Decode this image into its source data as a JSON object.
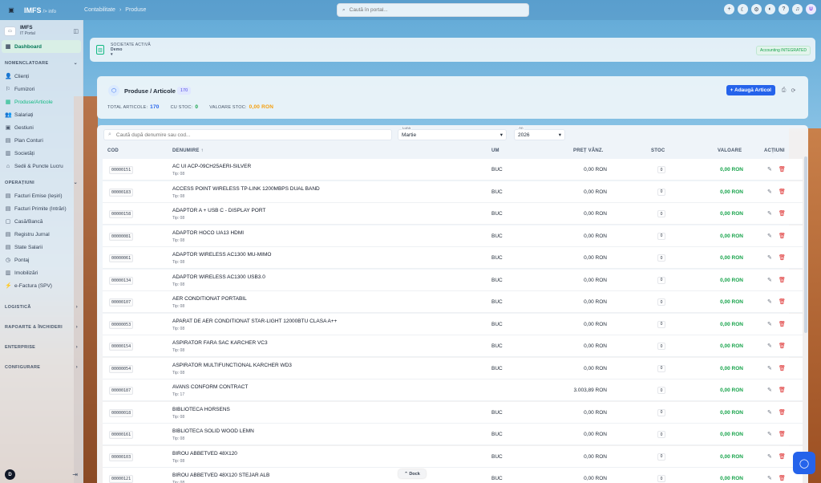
{
  "topbar": {
    "brand": "IMFS",
    "brand_sub": "/> info",
    "crumb1": "Contabilitate",
    "crumb2": "Produse",
    "search_placeholder": "Caută în portal...",
    "avatar": "U"
  },
  "sidebar": {
    "title": "IMFS",
    "subtitle": "IT Portal",
    "dashboard": "Dashboard",
    "sec1": "NOMENCLATOARE",
    "items1": [
      "Clienți",
      "Furnizori",
      "Produse/Articole",
      "Salariați",
      "Gestiuni",
      "Plan Conturi",
      "Societăți",
      "Sedii & Puncte Lucru"
    ],
    "sec2": "OPERAȚIUNI",
    "items2": [
      "Facturi Emise (Ieșiri)",
      "Facturi Primite (Intrări)",
      "Casă/Bancă",
      "Registru Jurnal",
      "State Salarii",
      "Pontaj",
      "Imobilizări",
      "e-Factura (SPV)"
    ],
    "sec3": "LOGISTICĂ",
    "sec4": "RAPOARTE & ÎNCHIDERI",
    "sec5": "ENTERPRISE",
    "sec6": "CONFIGURARE",
    "foot_avatar": "D"
  },
  "company": {
    "label": "SOCIETATE ACTIVĂ",
    "name": "Demo",
    "badge": "Accounting INTEGRATED"
  },
  "products": {
    "title": "Produse / Articole",
    "count": "170",
    "total_label": "TOTAL ARTICOLE:",
    "total": "170",
    "stoc_label": "CU STOC:",
    "stoc": "0",
    "val_label": "VALOARE STOC:",
    "val": "0,00 RON",
    "add": "+ Adaugă Articol"
  },
  "filters": {
    "search_placeholder": "Caută după denumire sau cod...",
    "luna_label": "Luna",
    "luna": "Martie",
    "an_label": "An",
    "an": "2026"
  },
  "cols": {
    "cod": "COD",
    "den": "DENUMIRE ↑",
    "um": "UM",
    "pret": "PREȚ VÂNZ.",
    "stoc": "STOC",
    "val": "VALOARE",
    "act": "ACȚIUNI"
  },
  "rows": [
    {
      "code": "00000151",
      "name": "AC UI ACP-09CH25AERI-SILVER",
      "tip": "Tip: 08",
      "um": "BUC",
      "pret": "0,00 RON",
      "stoc": "0",
      "val": "0,00 RON"
    },
    {
      "code": "00000183",
      "name": "ACCESS POINT WIRELESS TP-LINK 1200MBPS DUAL BAND",
      "tip": "Tip: 08",
      "um": "BUC",
      "pret": "0,00 RON",
      "stoc": "0",
      "val": "0,00 RON"
    },
    {
      "code": "00000158",
      "name": "ADAPTOR A + USB C - DISPLAY PORT",
      "tip": "Tip: 08",
      "um": "BUC",
      "pret": "0,00 RON",
      "stoc": "0",
      "val": "0,00 RON"
    },
    {
      "code": "00000081",
      "name": "ADAPTOR HOCO UA13 HDMI",
      "tip": "Tip: 08",
      "um": "BUC",
      "pret": "0,00 RON",
      "stoc": "0",
      "val": "0,00 RON"
    },
    {
      "code": "00000061",
      "name": "ADAPTOR WIRELESS AC1300 MU-MIMO",
      "tip": "Tip: 08",
      "um": "BUC",
      "pret": "0,00 RON",
      "stoc": "0",
      "val": "0,00 RON"
    },
    {
      "code": "00000134",
      "name": "ADAPTOR WIRELESS AC1300 USB3.0",
      "tip": "Tip: 08",
      "um": "BUC",
      "pret": "0,00 RON",
      "stoc": "0",
      "val": "0,00 RON"
    },
    {
      "code": "00000107",
      "name": "AER CONDITIONAT PORTABIL",
      "tip": "Tip: 08",
      "um": "BUC",
      "pret": "0,00 RON",
      "stoc": "0",
      "val": "0,00 RON"
    },
    {
      "code": "00000053",
      "name": "APARAT DE AER CONDITIONAT STAR-LIGHT 12000BTU CLASA A++",
      "tip": "Tip: 08",
      "um": "BUC",
      "pret": "0,00 RON",
      "stoc": "0",
      "val": "0,00 RON"
    },
    {
      "code": "00000154",
      "name": "ASPIRATOR FARA SAC KARCHER VC3",
      "tip": "Tip: 08",
      "um": "BUC",
      "pret": "0,00 RON",
      "stoc": "0",
      "val": "0,00 RON"
    },
    {
      "code": "00000054",
      "name": "ASPIRATOR MULTIFUNCTIONAL KARCHER WD3",
      "tip": "Tip: 08",
      "um": "BUC",
      "pret": "0,00 RON",
      "stoc": "0",
      "val": "0,00 RON"
    },
    {
      "code": "00000187",
      "name": "AVANS CONFORM CONTRACT",
      "tip": "Tip: 17",
      "um": "",
      "pret": "3.003,89 RON",
      "stoc": "0",
      "val": "0,00 RON"
    },
    {
      "code": "00000018",
      "name": "BIBLIOTECA HORSENS",
      "tip": "Tip: 08",
      "um": "BUC",
      "pret": "0,00 RON",
      "stoc": "0",
      "val": "0,00 RON"
    },
    {
      "code": "00000161",
      "name": "BIBLIOTECA SOLID WOOD LEMN",
      "tip": "Tip: 08",
      "um": "BUC",
      "pret": "0,00 RON",
      "stoc": "0",
      "val": "0,00 RON"
    },
    {
      "code": "00000103",
      "name": "BIROU ABBETVED 48X120",
      "tip": "Tip: 08",
      "um": "BUC",
      "pret": "0,00 RON",
      "stoc": "0",
      "val": "0,00 RON"
    },
    {
      "code": "00000121",
      "name": "BIROU ABBETVED 48X120 STEJAR ALB",
      "tip": "Tip: 08",
      "um": "BUC",
      "pret": "0,00 RON",
      "stoc": "0",
      "val": "0,00 RON"
    }
  ],
  "dock": "⌃ Dock"
}
